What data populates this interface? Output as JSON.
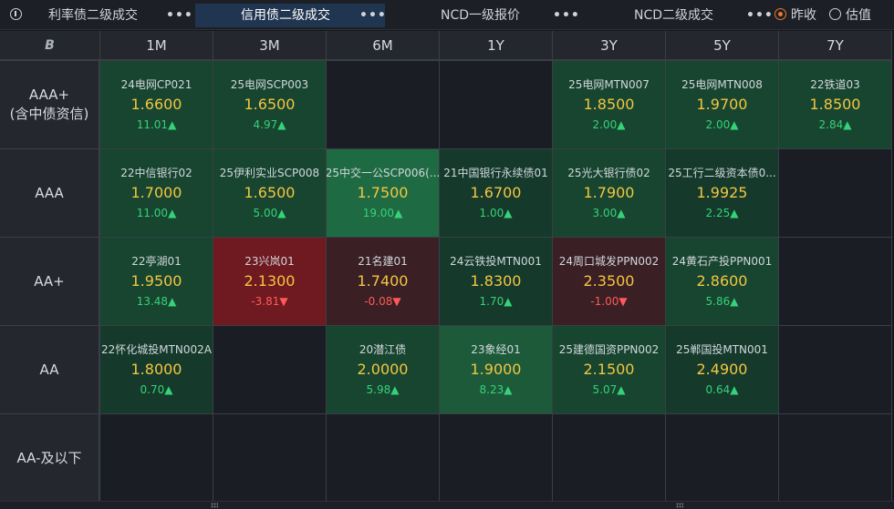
{
  "tabs": [
    {
      "label": "利率债二级成交",
      "active": false
    },
    {
      "label": "信用债二级成交",
      "active": true
    },
    {
      "label": "NCD一级报价",
      "active": false
    },
    {
      "label": "NCD二级成交",
      "active": false
    }
  ],
  "more_label": "•••",
  "radio": [
    {
      "label": "昨收",
      "checked": true
    },
    {
      "label": "估值",
      "checked": false
    }
  ],
  "corner_icon": "B",
  "columns": [
    "1M",
    "3M",
    "6M",
    "1Y",
    "3Y",
    "5Y",
    "7Y"
  ],
  "rows": [
    {
      "label": "AAA+\n(含中债资信)",
      "label_lines": [
        "AAA+",
        "(含中债资信)"
      ],
      "cells": [
        {
          "name": "24电网CP021",
          "value": "1.6600",
          "change": "11.01",
          "dir": "up",
          "tone": "g2"
        },
        {
          "name": "25电网SCP003",
          "value": "1.6500",
          "change": "4.97",
          "dir": "up",
          "tone": "g2"
        },
        null,
        null,
        {
          "name": "25电网MTN007",
          "value": "1.8500",
          "change": "2.00",
          "dir": "up",
          "tone": "g2"
        },
        {
          "name": "25电网MTN008",
          "value": "1.9700",
          "change": "2.00",
          "dir": "up",
          "tone": "g2"
        },
        {
          "name": "22铁道03",
          "value": "1.8500",
          "change": "2.84",
          "dir": "up",
          "tone": "g2"
        }
      ]
    },
    {
      "label_lines": [
        "AAA"
      ],
      "cells": [
        {
          "name": "22中信银行02",
          "value": "1.7000",
          "change": "11.00",
          "dir": "up",
          "tone": "g2"
        },
        {
          "name": "25伊利实业SCP008",
          "value": "1.6500",
          "change": "5.00",
          "dir": "up",
          "tone": "g2"
        },
        {
          "name": "25中交一公SCP006(...",
          "value": "1.7500",
          "change": "19.00",
          "dir": "up",
          "tone": "g4"
        },
        {
          "name": "21中国银行永续债01",
          "value": "1.6700",
          "change": "1.00",
          "dir": "up",
          "tone": "g1"
        },
        {
          "name": "25光大银行债02",
          "value": "1.7900",
          "change": "3.00",
          "dir": "up",
          "tone": "g2"
        },
        {
          "name": "25工行二级资本债0...",
          "value": "1.9925",
          "change": "2.25",
          "dir": "up",
          "tone": "g1"
        },
        null
      ]
    },
    {
      "label_lines": [
        "AA+"
      ],
      "cells": [
        {
          "name": "22亭湖01",
          "value": "1.9500",
          "change": "13.48",
          "dir": "up",
          "tone": "g2"
        },
        {
          "name": "23兴岚01",
          "value": "2.1300",
          "change": "-3.81",
          "dir": "down",
          "tone": "r2"
        },
        {
          "name": "21名建01",
          "value": "1.7400",
          "change": "-0.08",
          "dir": "down",
          "tone": "r1"
        },
        {
          "name": "24云铁投MTN001",
          "value": "1.8300",
          "change": "1.70",
          "dir": "up",
          "tone": "g1"
        },
        {
          "name": "24周口城发PPN002",
          "value": "2.3500",
          "change": "-1.00",
          "dir": "down",
          "tone": "r1"
        },
        {
          "name": "24黄石产投PPN001",
          "value": "2.8600",
          "change": "5.86",
          "dir": "up",
          "tone": "g2"
        },
        null
      ]
    },
    {
      "label_lines": [
        "AA"
      ],
      "cells": [
        {
          "name": "22怀化城投MTN002A",
          "value": "1.8000",
          "change": "0.70",
          "dir": "up",
          "tone": "g1"
        },
        null,
        {
          "name": "20潜江债",
          "value": "2.0000",
          "change": "5.98",
          "dir": "up",
          "tone": "g2"
        },
        {
          "name": "23象经01",
          "value": "1.9000",
          "change": "8.23",
          "dir": "up",
          "tone": "g3"
        },
        {
          "name": "25建德国资PPN002",
          "value": "2.1500",
          "change": "5.07",
          "dir": "up",
          "tone": "g2"
        },
        {
          "name": "25郸国投MTN001",
          "value": "2.4900",
          "change": "0.64",
          "dir": "up",
          "tone": "g1"
        },
        null
      ]
    },
    {
      "label_lines": [
        "AA-及以下"
      ],
      "cells": [
        null,
        null,
        null,
        null,
        null,
        null,
        null
      ]
    }
  ],
  "arrow_up": "▲",
  "arrow_down": "▼"
}
